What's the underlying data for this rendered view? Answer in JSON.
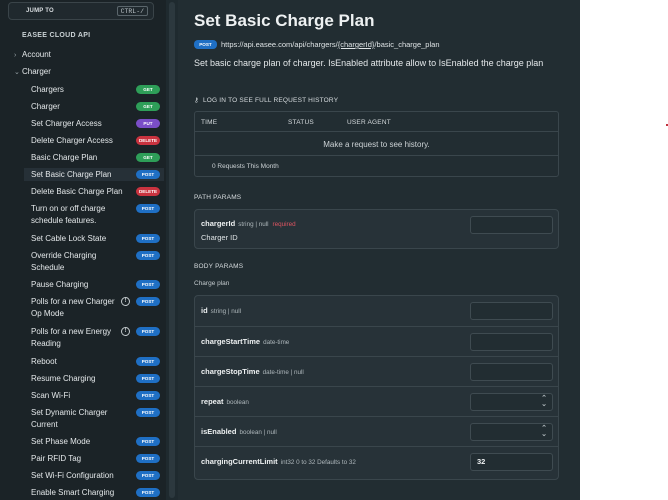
{
  "sidebar": {
    "jump_label": "JUMP TO",
    "jump_shortcut": "CTRL-/",
    "api_title": "EASEE CLOUD API",
    "groups": [
      {
        "label": "Account",
        "expanded": false
      },
      {
        "label": "Charger",
        "expanded": true
      }
    ],
    "items": [
      {
        "label": "Chargers",
        "method": "GET"
      },
      {
        "label": "Charger",
        "method": "GET"
      },
      {
        "label": "Set Charger Access",
        "method": "PUT"
      },
      {
        "label": "Delete Charger Access",
        "method": "DELETE"
      },
      {
        "label": "Basic Charge Plan",
        "method": "GET"
      },
      {
        "label": "Set Basic Charge Plan",
        "method": "POST",
        "active": true
      },
      {
        "label": "Delete Basic Charge Plan",
        "method": "DELETE"
      },
      {
        "label": "Turn on or off charge",
        "label2": "schedule features.",
        "method": "POST"
      },
      {
        "label": "Set Cable Lock State",
        "method": "POST"
      },
      {
        "label": "Override Charging",
        "label2": "Schedule",
        "method": "POST"
      },
      {
        "label": "Pause Charging",
        "method": "POST"
      },
      {
        "label": "Polls for a new Charger",
        "label2": "Op Mode",
        "method": "POST",
        "info": true
      },
      {
        "label": "Polls for a new Energy",
        "label2": "Reading",
        "method": "POST",
        "info": true
      },
      {
        "label": "Reboot",
        "method": "POST"
      },
      {
        "label": "Resume Charging",
        "method": "POST"
      },
      {
        "label": "Scan Wi-Fi",
        "method": "POST"
      },
      {
        "label": "Set Dynamic Charger",
        "label2": "Current",
        "method": "POST"
      },
      {
        "label": "Set Phase Mode",
        "method": "POST"
      },
      {
        "label": "Pair RFID Tag",
        "method": "POST"
      },
      {
        "label": "Set Wi-Fi Configuration",
        "method": "POST"
      },
      {
        "label": "Enable Smart Charging",
        "method": "POST"
      }
    ]
  },
  "endpoint": {
    "title": "Set Basic Charge Plan",
    "method": "POST",
    "url_prefix": "https://api.easee.com/api/chargers/",
    "url_param": "{chargerId}",
    "url_suffix": "/basic_charge_plan",
    "description": "Set basic charge plan of charger. IsEnabled attribute allow to IsEnabled the charge plan"
  },
  "history": {
    "heading": "LOG IN TO SEE FULL REQUEST HISTORY",
    "columns": [
      "TIME",
      "STATUS",
      "USER AGENT"
    ],
    "empty_text": "Make a request to see history.",
    "count_text": "0 Requests This Month"
  },
  "path_params": {
    "heading": "PATH PARAMS",
    "params": [
      {
        "name": "chargerId",
        "type": "string | null",
        "required": "required",
        "description": "Charger ID",
        "value": ""
      }
    ]
  },
  "body_params": {
    "heading": "BODY PARAMS",
    "subheading": "Charge plan",
    "params": [
      {
        "name": "id",
        "type": "string | null",
        "value": "",
        "control": "text"
      },
      {
        "name": "chargeStartTime",
        "type": "date-time",
        "value": "",
        "control": "text"
      },
      {
        "name": "chargeStopTime",
        "type": "date-time | null",
        "value": "",
        "control": "text"
      },
      {
        "name": "repeat",
        "type": "boolean",
        "value": "",
        "control": "select"
      },
      {
        "name": "isEnabled",
        "type": "boolean | null",
        "value": "",
        "control": "select"
      },
      {
        "name": "chargingCurrentLimit",
        "type": "int32  0 to 32  Defaults to 32",
        "value": "32",
        "control": "text"
      }
    ]
  },
  "colors": {
    "get": "#2e9e58",
    "post": "#1f6fc4",
    "put": "#7a4ec7",
    "delete": "#c9333f",
    "required": "#e05562"
  }
}
